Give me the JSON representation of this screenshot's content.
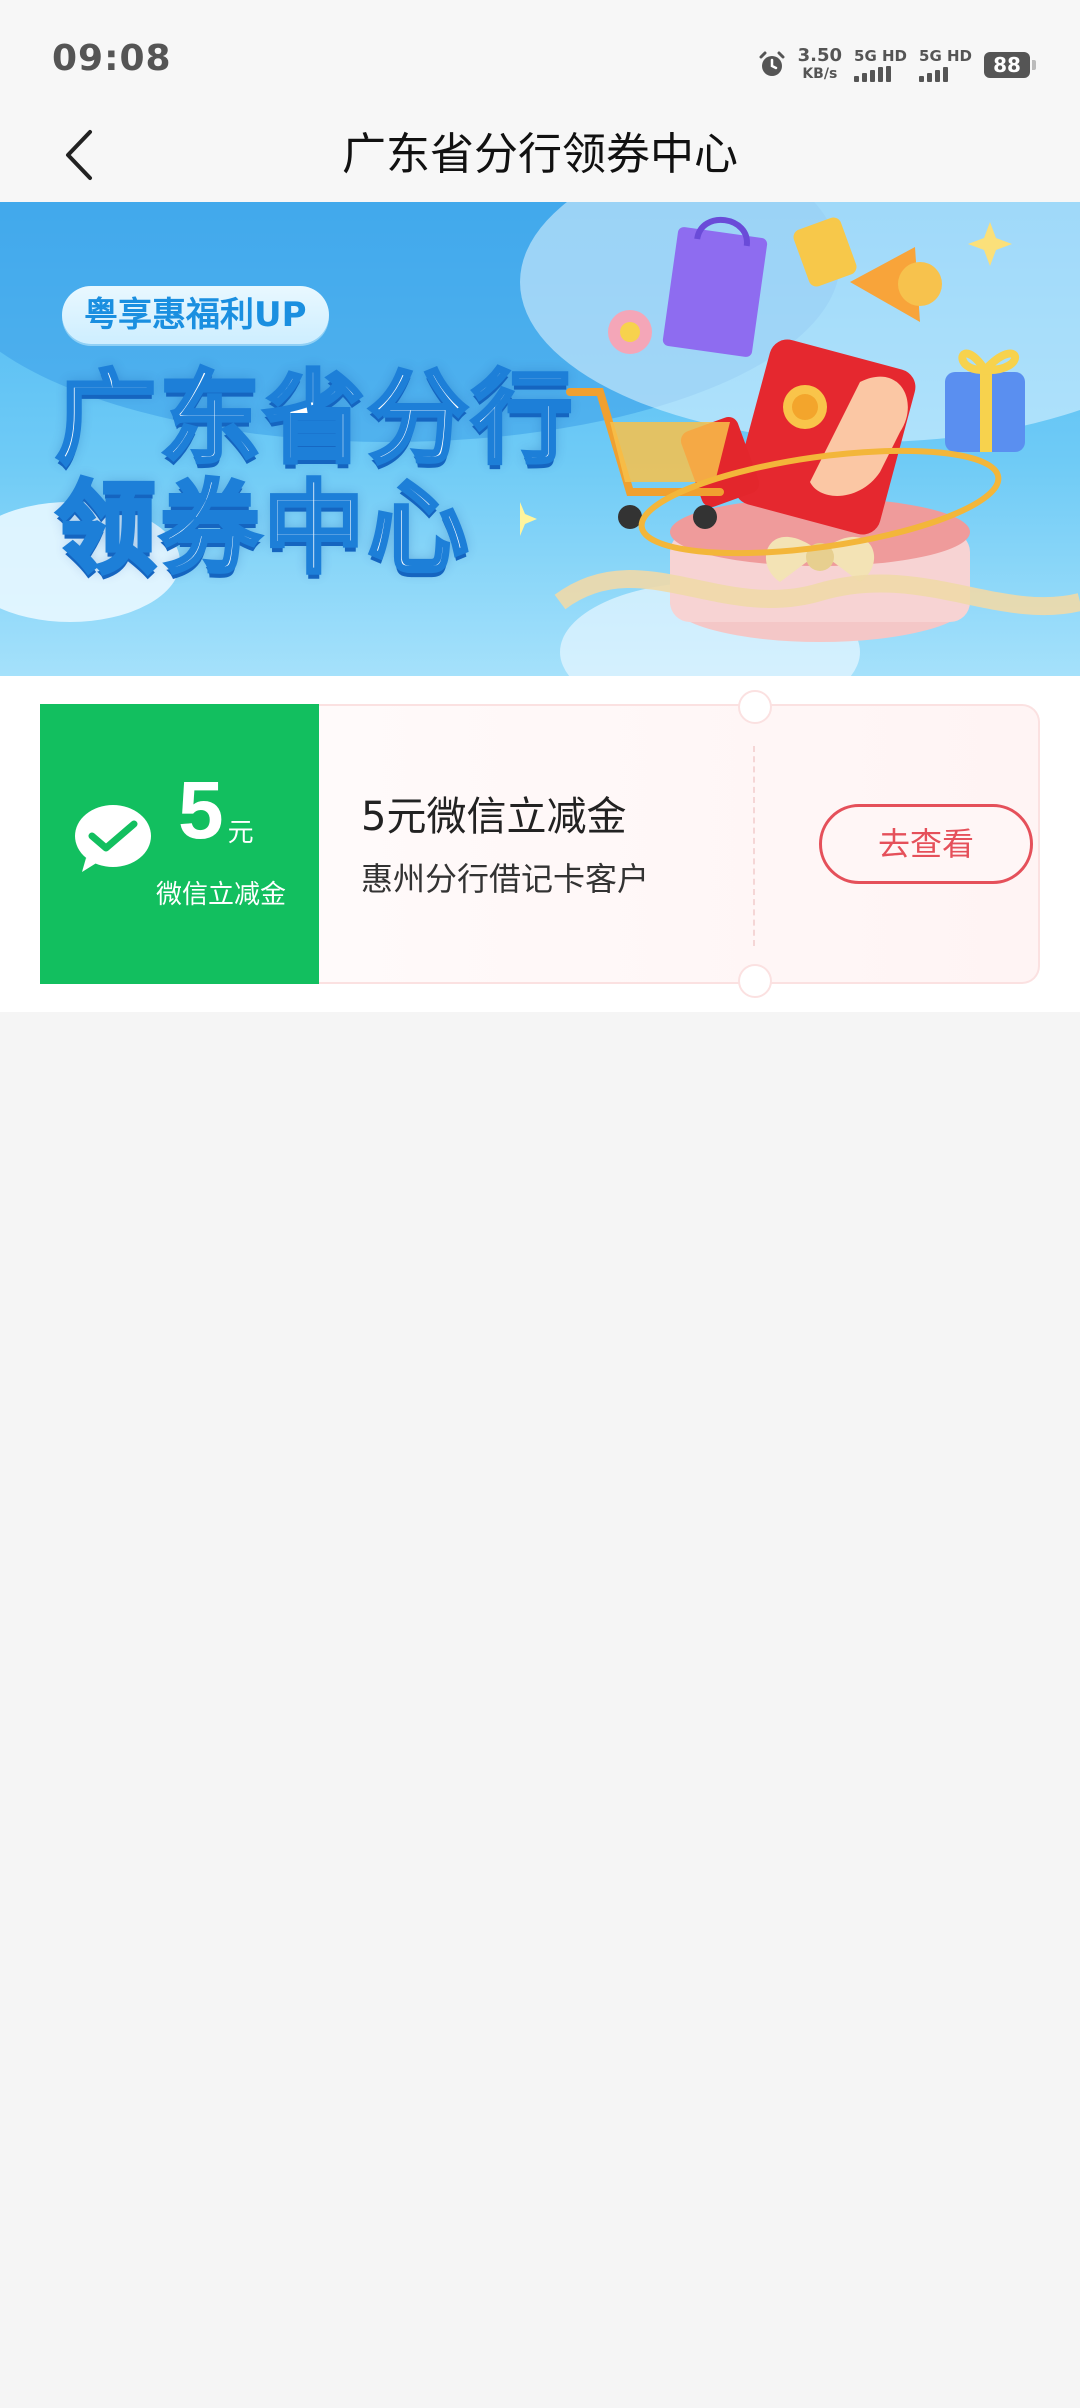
{
  "status_bar": {
    "time": "09:08",
    "net_speed_value": "3.50",
    "net_speed_unit": "KB/s",
    "sim1_label": "5G HD",
    "sim2_label": "5G HD",
    "battery": "88"
  },
  "nav": {
    "title": "广东省分行领券中心"
  },
  "banner": {
    "tag": "粤享惠福利UP",
    "title_line1": "广东省分行",
    "title_line2": "领券中心"
  },
  "coupon": {
    "amount": "5",
    "amount_unit": "元",
    "amount_label": "微信立减金",
    "title": "5元微信立减金",
    "description": "惠州分行借记卡客户",
    "button_label": "去查看",
    "accent_color": "#12bf5f",
    "button_color": "#e5505a"
  }
}
